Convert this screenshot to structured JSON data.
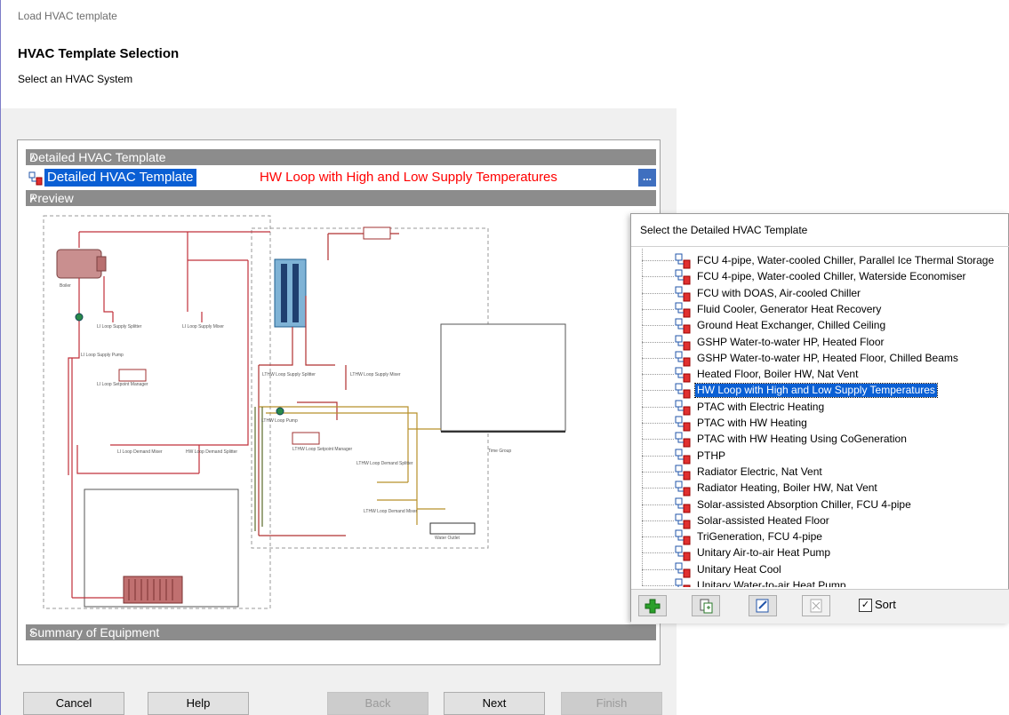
{
  "window": {
    "title": "Load HVAC template"
  },
  "header": {
    "title": "HVAC Template Selection",
    "subtitle": "Select an HVAC System"
  },
  "sections": {
    "detailed": "Detailed HVAC Template",
    "preview": "Preview",
    "summary": "Summary of Equipment"
  },
  "template_row": {
    "label": "Detailed HVAC Template",
    "value": "HW Loop with High and Low Supply Temperatures",
    "browse": "..."
  },
  "buttons": {
    "cancel": "Cancel",
    "help": "Help",
    "back": "Back",
    "next": "Next",
    "finish": "Finish"
  },
  "popup": {
    "title": "Select the Detailed HVAC Template",
    "selected_index": 9,
    "items": [
      "FCU 4-pipe, Water-cooled Chiller, Parallel Ice Thermal Storage",
      "FCU 4-pipe, Water-cooled Chiller, Waterside Economiser",
      "FCU with DOAS, Air-cooled Chiller",
      "Fluid Cooler, Generator Heat Recovery",
      "Ground Heat Exchanger, Chilled Ceiling",
      "GSHP Water-to-water HP, Heated Floor",
      "GSHP Water-to-water HP, Heated Floor, Chilled Beams",
      "Heated Floor, Boiler HW, Nat Vent",
      "HW Loop with High and Low Supply Temperatures",
      "PTAC with Electric Heating",
      "PTAC with HW Heating",
      "PTAC with HW Heating Using CoGeneration",
      "PTHP",
      "Radiator Electric, Nat Vent",
      "Radiator Heating, Boiler HW, Nat Vent",
      "Solar-assisted Absorption Chiller, FCU 4-pipe",
      "Solar-assisted Heated Floor",
      "TriGeneration, FCU 4-pipe",
      "Unitary Air-to-air Heat Pump",
      "Unitary Heat Cool",
      "Unitary Water-to-air Heat Pump"
    ],
    "sort_label": "Sort",
    "sort_checked": true
  },
  "colors": {
    "accent": "#0a5fd4",
    "group_header": "#8c8c8c",
    "value_text": "#ff0000"
  }
}
